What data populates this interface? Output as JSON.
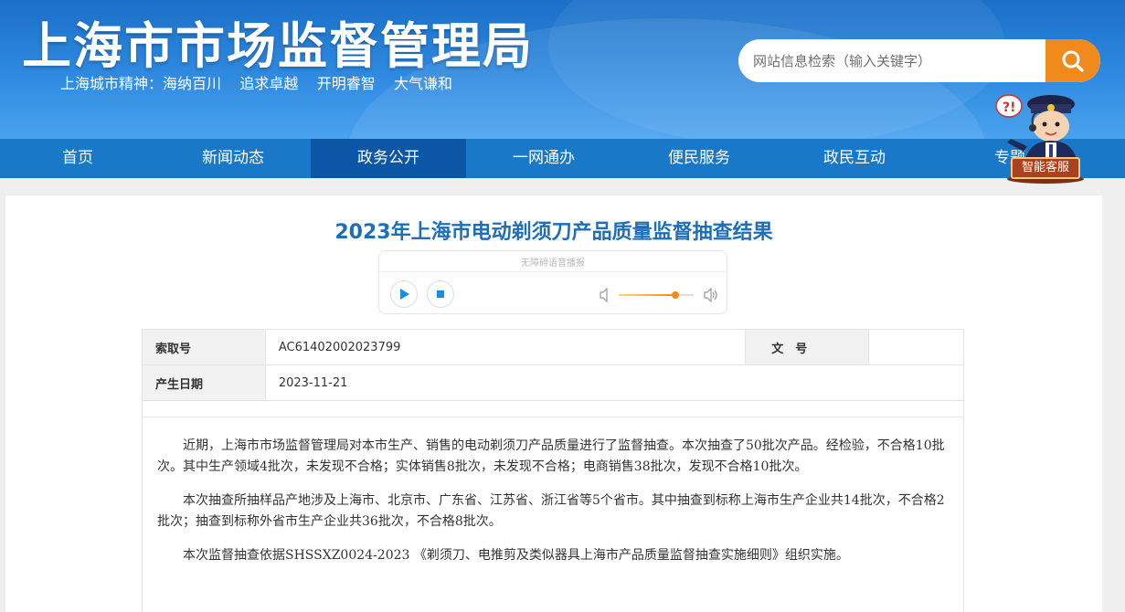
{
  "header": {
    "site_title": "上海市市场监督管理局",
    "slogan": "上海城市精神：海纳百川    追求卓越    开明睿智    大气谦和",
    "search_placeholder": "网站信息检索（输入关键字）"
  },
  "nav": {
    "items": [
      {
        "label": "首页"
      },
      {
        "label": "新闻动态"
      },
      {
        "label": "政务公开",
        "active": true
      },
      {
        "label": "一网通办"
      },
      {
        "label": "便民服务"
      },
      {
        "label": "政民互动"
      },
      {
        "label": "专题"
      }
    ]
  },
  "assistant": {
    "label": "智能客服"
  },
  "article": {
    "title": "2023年上海市电动剃须刀产品质量监督抽查结果",
    "player": {
      "caption": "无障碍语音播报",
      "volume_fraction": 0.75
    },
    "meta": {
      "index_label": "索取号",
      "index_value": "AC61402002023799",
      "doc_no_label": "文　号",
      "doc_no_value": "",
      "date_label": "产生日期",
      "date_value": "2023-11-21"
    },
    "paragraphs": [
      "近期，上海市市场监督管理局对本市生产、销售的电动剃须刀产品质量进行了监督抽查。本次抽查了50批次产品。经检验，不合格10批次。其中生产领域4批次，未发现不合格；实体销售8批次，未发现不合格；电商销售38批次，发现不合格10批次。",
      "本次抽查所抽样品产地涉及上海市、北京市、广东省、江苏省、浙江省等5个省市。其中抽查到标称上海市生产企业共14批次，不合格2批次；抽查到标称外省市生产企业共36批次，不合格8批次。",
      "本次监督抽查依据SHSSXZ0024-2023 《剃须刀、电推剪及类似器具上海市产品质量监督抽查实施细则》组织实施。"
    ]
  }
}
